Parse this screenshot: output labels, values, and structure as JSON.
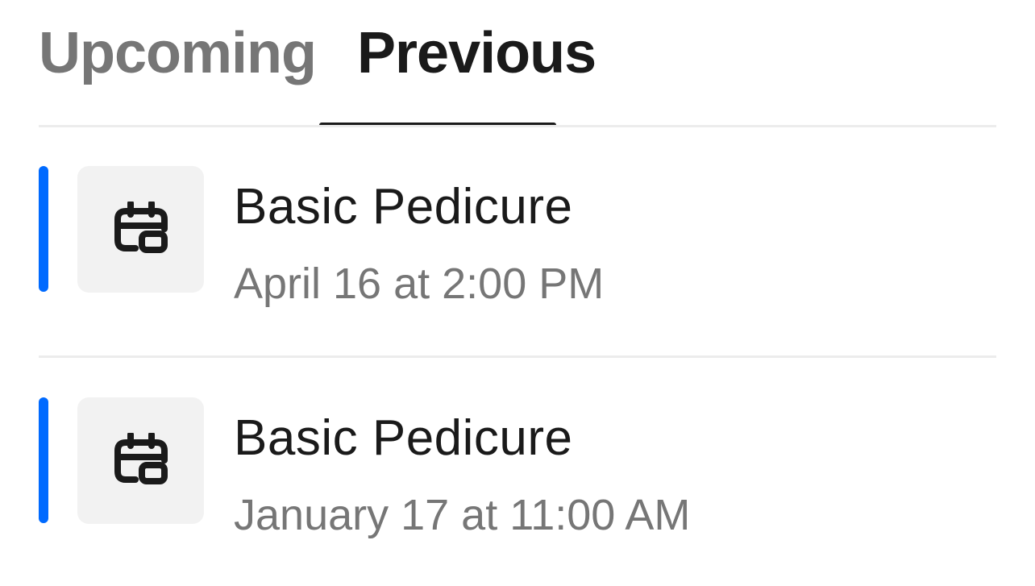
{
  "tabs": [
    {
      "label": "Upcoming",
      "selected": false
    },
    {
      "label": "Previous",
      "selected": true
    }
  ],
  "appointments": [
    {
      "title": "Basic Pedicure",
      "datetime": "April 16 at 2:00 PM",
      "icon": "calendar-icon"
    },
    {
      "title": "Basic Pedicure",
      "datetime": "January 17 at 11:00 AM",
      "icon": "calendar-icon"
    }
  ],
  "colors": {
    "accent": "#006aff",
    "text_primary": "#1a1a1a",
    "text_secondary": "#767676",
    "divider": "#ececec",
    "thumb_bg": "#f2f2f2"
  }
}
